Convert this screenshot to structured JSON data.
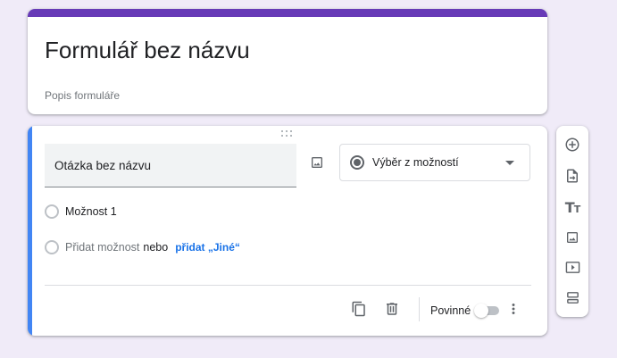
{
  "form": {
    "title": "Formulář bez názvu",
    "description": "Popis formuláře"
  },
  "question": {
    "title": "Otázka bez názvu",
    "type_label": "Výběr z možností",
    "options": [
      "Možnost 1"
    ],
    "add_option_label": "Přidat možnost",
    "or_label": "nebo",
    "add_other_label": "přidat „Jiné“",
    "required_label": "Povinné",
    "required": false
  },
  "toolbar": {
    "icons": [
      "add-question-icon",
      "import-questions-icon",
      "add-title-icon",
      "add-image-icon",
      "add-video-icon",
      "add-section-icon"
    ]
  },
  "colors": {
    "background": "#f0ebf8",
    "accent": "#673ab7",
    "active_bar": "#4285f4",
    "link": "#1a73e8"
  }
}
